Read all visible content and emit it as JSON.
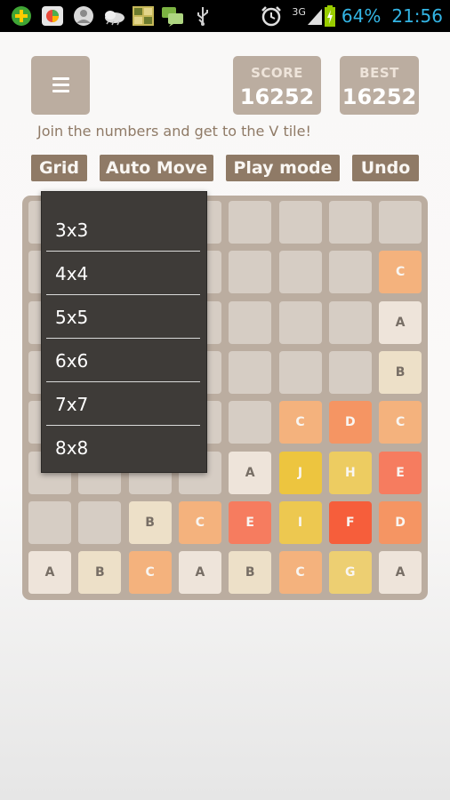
{
  "status_bar": {
    "icons": [
      "plus-circle-icon",
      "app-store-icon",
      "contacts-icon",
      "weather-icon",
      "gallery-icon",
      "chat-icon",
      "usb-icon"
    ],
    "alarm_icon": "alarm-clock-icon",
    "network": "3G",
    "battery": "64%",
    "time": "21:56"
  },
  "header": {
    "menu_icon": "hamburger-menu-icon",
    "score_label": "SCORE",
    "score_value": "16252",
    "best_label": "BEST",
    "best_value": "16252",
    "tagline": "Join the numbers and get to the V tile!"
  },
  "toolbar": {
    "grid": "Grid",
    "auto_move": "Auto Move",
    "play_mode": "Play mode",
    "undo": "Undo"
  },
  "grid_menu": {
    "items": [
      "3x3",
      "4x4",
      "5x5",
      "6x6",
      "7x7",
      "8x8"
    ]
  },
  "board": {
    "size": 8,
    "rows": [
      [
        "",
        "",
        "",
        "",
        "",
        "",
        "",
        ""
      ],
      [
        "",
        "",
        "",
        "",
        "",
        "",
        "",
        "C"
      ],
      [
        "",
        "",
        "",
        "",
        "",
        "",
        "",
        "A"
      ],
      [
        "",
        "",
        "",
        "",
        "",
        "",
        "",
        "B"
      ],
      [
        "",
        "",
        "",
        "",
        "",
        "C",
        "D",
        "C"
      ],
      [
        "",
        "",
        "",
        "",
        "A",
        "J",
        "H",
        "E"
      ],
      [
        "",
        "",
        "B",
        "C",
        "E",
        "I",
        "F",
        "D"
      ],
      [
        "A",
        "B",
        "C",
        "A",
        "B",
        "C",
        "G",
        "A"
      ]
    ]
  },
  "colors": {
    "board": "#bbada0",
    "empty": "#d6cdc4",
    "A": "#eee4da",
    "B": "#ede0c8",
    "C": "#f4b27d",
    "D": "#f59563",
    "E": "#f67c5f",
    "F": "#f65e3b",
    "G": "#edcf72",
    "H": "#edcc61",
    "I": "#edc850",
    "J": "#edc53f"
  }
}
